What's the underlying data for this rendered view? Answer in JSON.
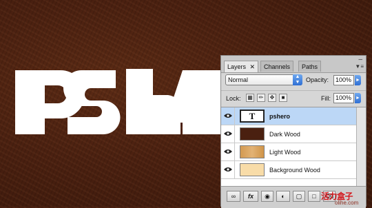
{
  "logo_text": "PSHE",
  "panel": {
    "tabs": [
      {
        "label": "Layers",
        "active": true,
        "close": "✕"
      },
      {
        "label": "Channels",
        "active": false
      },
      {
        "label": "Paths",
        "active": false
      }
    ],
    "close_icon": "panel-close",
    "menu_icon": "panel-menu",
    "blend_mode": "Normal",
    "opacity_label": "Opacity:",
    "opacity_value": "100%",
    "lock_label": "Lock:",
    "fill_label": "Fill:",
    "fill_value": "100%",
    "layers": [
      {
        "name": "pshero",
        "thumb": "T",
        "thumb_type": "text",
        "selected": true
      },
      {
        "name": "Dark Wood",
        "thumb_color": "#4a2010"
      },
      {
        "name": "Light Wood",
        "thumb_color": "#d7a35c"
      },
      {
        "name": "Background Wood",
        "thumb_color": "#f8dca8"
      }
    ],
    "bottom_buttons": [
      "link-icon",
      "fx",
      "mask-icon",
      "adjustment-icon",
      "group-icon",
      "new-layer-icon",
      "trash-icon"
    ],
    "bottom_fx_label": "fx"
  },
  "watermark": "活力盒子",
  "watermark_sub": "olihe.com",
  "colors": {
    "accent_blue": "#2f6fd4",
    "selection": "#bcd7f6",
    "wood": "#4a2010"
  }
}
